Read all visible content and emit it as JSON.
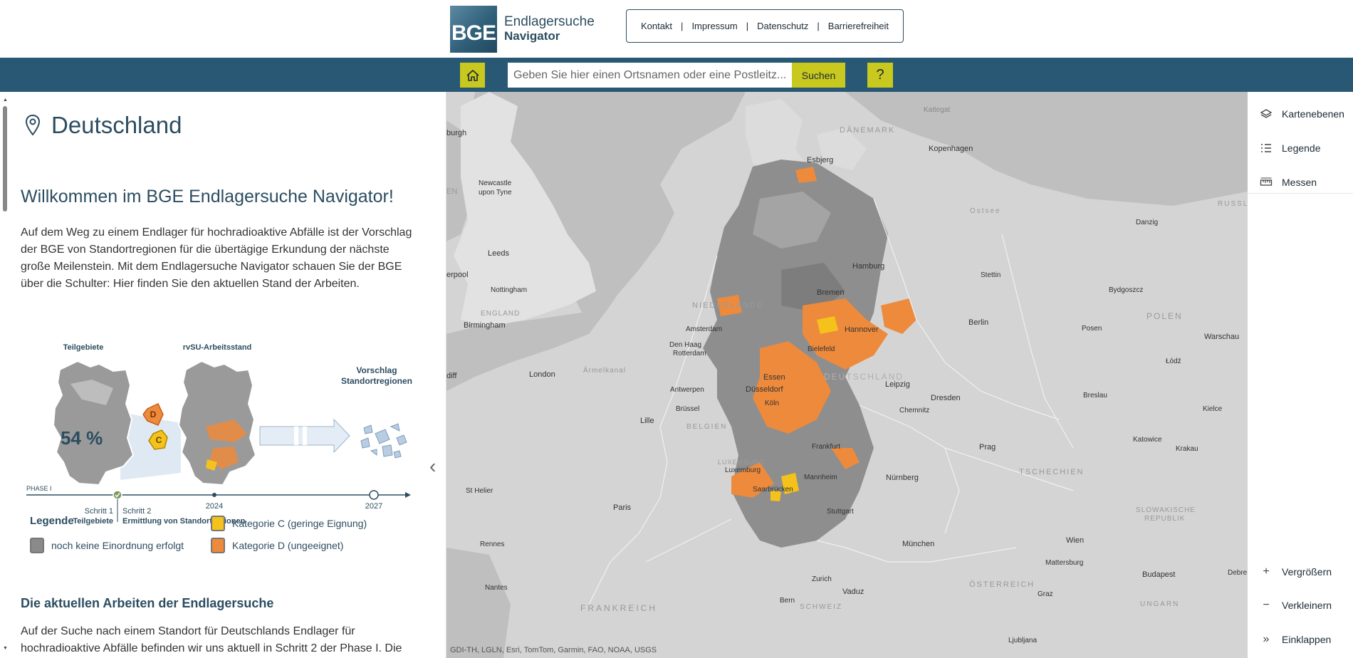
{
  "header": {
    "logo_box": "BGE",
    "logo_line1": "Endlagersuche",
    "logo_line2": "Navigator",
    "links": [
      "Kontakt",
      "Impressum",
      "Datenschutz",
      "Barrierefreiheit"
    ]
  },
  "search": {
    "placeholder": "Geben Sie hier einen Ortsnamen oder eine Postleitz...",
    "button_label": "Suchen",
    "help_label": "?"
  },
  "panel": {
    "location_title": "Deutschland",
    "welcome_title": "Willkommen im BGE Endlagersuche Navigator!",
    "intro_text": "Auf dem Weg zu einem Endlager für hochradioaktive Abfälle ist der Vorschlag der BGE von Standortregionen für die übertägige Erkundung der nächste große Meilenstein. Mit dem Endlagersuche Navigator schauen Sie der BGE über die Schulter: Hier finden Sie den aktuellen Stand der Arbeiten.",
    "infographic": {
      "label_teilgebiete": "Teilgebiete",
      "label_rvsu": "rvSU-Arbeitsstand",
      "label_vorschlag_1": "Vorschlag",
      "label_vorschlag_2": "Standortregionen",
      "percent": "54 %",
      "badge_d": "D",
      "badge_c": "C",
      "phase": "PHASE I",
      "step1_a": "Schritt 1",
      "step1_b": "Teilgebiete",
      "step2_a": "Schritt 2",
      "step2_b": "Ermittlung von Standortregionen",
      "year_2024": "2024",
      "year_2027": "2027"
    },
    "legend": {
      "title": "Legende",
      "items": [
        {
          "label": "noch keine Einordnung erfolgt",
          "color": "#8a8a8a"
        },
        {
          "label": "Kategorie C (geringe Eignung)",
          "color": "#f5c21b"
        },
        {
          "label": "Kategorie D (ungeeignet)",
          "color": "#ee8a3c"
        }
      ]
    },
    "section_title": "Die aktuellen Arbeiten der Endlagersuche",
    "section_text": "Auf der Suche nach einem Standort für Deutschlands Endlager für hochradioaktive Abfälle befinden wir uns aktuell in Schritt 2 der Phase I. Die"
  },
  "map": {
    "attribution": "GDI-TH, LGLN, Esri, TomTom, Garmin, FAO, NOAA, USGS",
    "labels": {
      "kattegat": "Kattegat",
      "daenemark": "DÄNEMARK",
      "kopenhagen": "Kopenhagen",
      "esbjerg": "Esbjerg",
      "burgh": "burgh",
      "newcastle1": "Newcastle",
      "newcastle2": "upon Tyne",
      "en": "EN",
      "ostsee": "Ostsee",
      "russland": "RUSSLA",
      "danzig": "Danzig",
      "leeds": "Leeds",
      "liverpool": "erpool",
      "nottingham": "Nottingham",
      "england": "ENGLAND",
      "birmingham": "Birmingham",
      "niederlande": "NIEDERLANDE",
      "amsterdam": "Amsterdam",
      "denhaag1": "Den Haag",
      "denhaag2": "Rotterdam",
      "hamburg": "Hamburg",
      "stettin": "Stettin",
      "bydgoszcz": "Bydgoszcz",
      "bremen": "Bremen",
      "polen": "POLEN",
      "hannover": "Hannover",
      "berlin": "Berlin",
      "posen": "Posen",
      "warschau": "Warschau",
      "bielefeld": "Bielefeld",
      "lodz": "Łódź",
      "cardiff": "diff",
      "london": "London",
      "aermelkanal": "Ärmelkanal",
      "essen": "Essen",
      "deutschland": "DEUTSCHLAND",
      "leipzig": "Leipzig",
      "antwerpen": "Antwerpen",
      "duesseldorf": "Düsseldorf",
      "dresden": "Dresden",
      "breslau": "Breslau",
      "bruessel": "Brüssel",
      "koeln": "Köln",
      "chemnitz": "Chemnitz",
      "kielce": "Kielce",
      "lille": "Lille",
      "belgien": "BELGIEN",
      "katowice": "Katowice",
      "frankfurt": "Frankfurt",
      "prag": "Prag",
      "krakau": "Krakau",
      "luxemburg1": "LUXEMBURG",
      "luxemburg2": "Luxemburg",
      "mannheim": "Mannheim",
      "nuernberg": "Nürnberg",
      "tschechien": "TSCHECHIEN",
      "sthelier": "St Helier",
      "saarbruecken": "Saarbrücken",
      "paris": "Paris",
      "stuttgart": "Stuttgart",
      "slowakische1": "SLOWAKISCHE",
      "slowakische2": "REPUBLIK",
      "rennes": "Rennes",
      "muenchen": "München",
      "wien": "Wien",
      "mattersburg": "Mattersburg",
      "budapest": "Budapest",
      "debrecen": "Debre",
      "zurich": "Zurich",
      "nantes": "Nantes",
      "vaduz": "Vaduz",
      "oesterreich": "ÖSTERREICH",
      "graz": "Graz",
      "bern": "Bern",
      "schweiz": "SCHWEIZ",
      "frankreich": "FRANKREICH",
      "ungarn": "UNGARN",
      "ljubljana": "Ljubljana"
    }
  },
  "tools": {
    "kartenebenen": "Kartenebenen",
    "legende": "Legende",
    "messen": "Messen",
    "vergroessern": "Vergrößern",
    "verkleinern": "Verkleinern",
    "einklappen": "Einklappen"
  }
}
